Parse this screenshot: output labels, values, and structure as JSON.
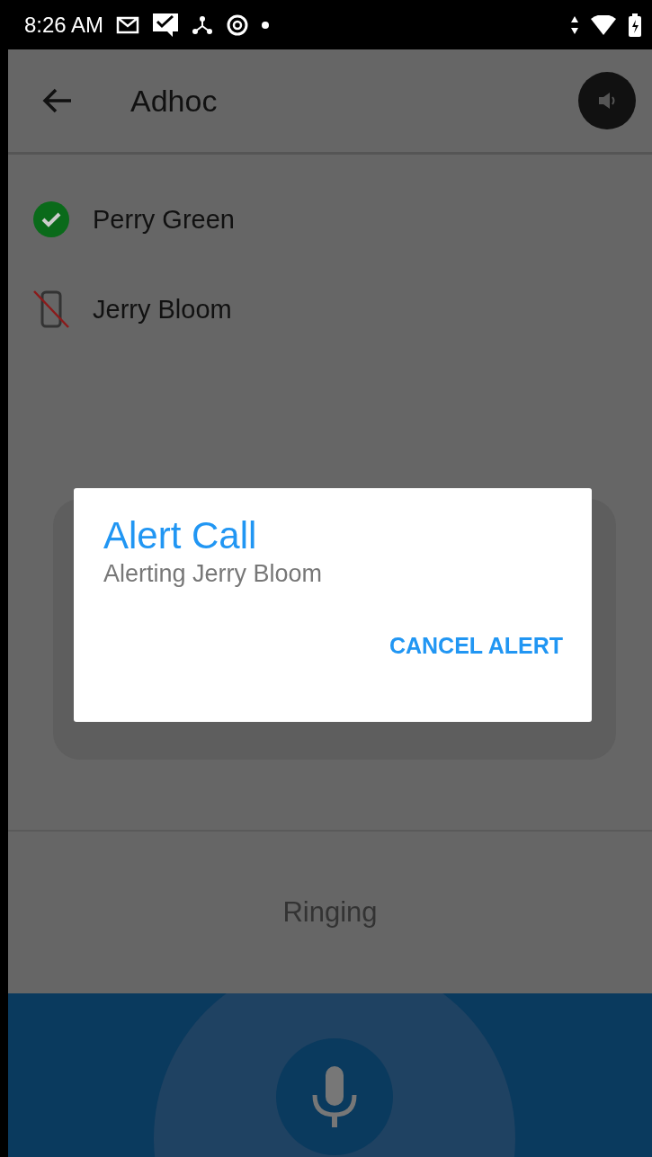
{
  "status_bar": {
    "time": "8:26 AM"
  },
  "app_bar": {
    "title": "Adhoc"
  },
  "participants": [
    {
      "name": "Perry Green",
      "kind": "joined"
    },
    {
      "name": "Jerry Bloom",
      "kind": "unreachable"
    }
  ],
  "dialog": {
    "title": "Alert Call",
    "message": "Alerting Jerry Bloom",
    "action": "CANCEL ALERT"
  },
  "call_status": "Ringing"
}
